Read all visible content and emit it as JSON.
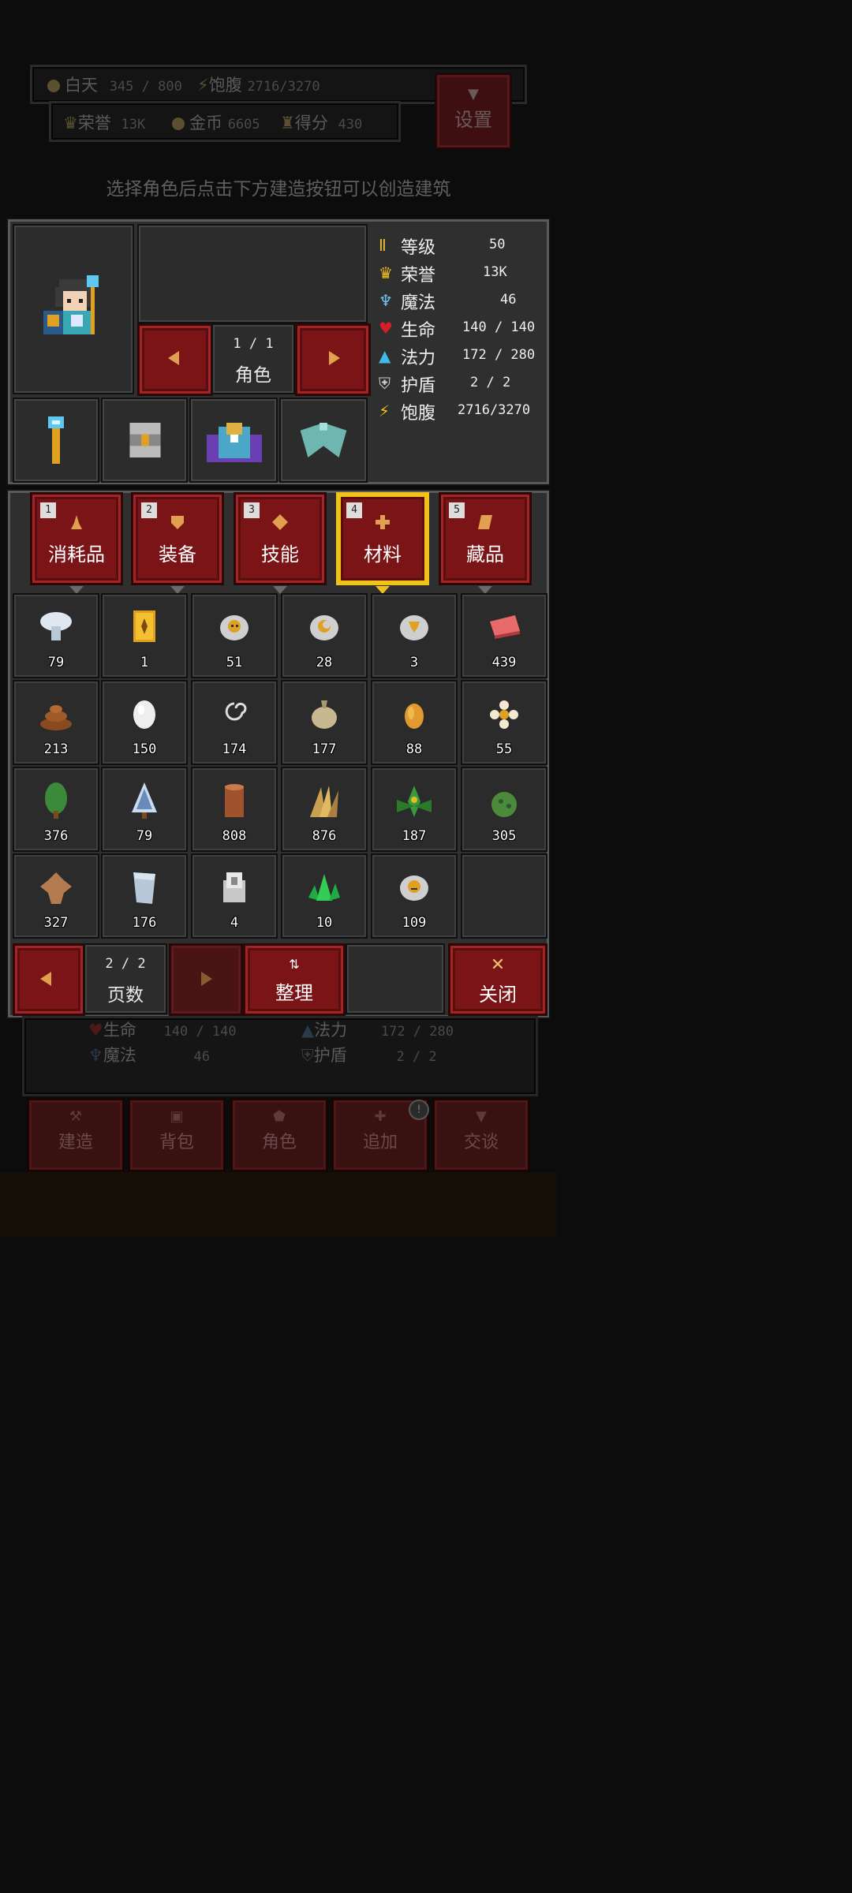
{
  "hud": {
    "day_label": "白天",
    "day_value": "345 / 800",
    "satiety_label": "饱腹",
    "satiety_value": "2716/3270",
    "honor_label": "荣誉",
    "honor_value": "13K",
    "gold_label": "金币",
    "gold_value": "6605",
    "score_label": "得分",
    "score_value": "430",
    "settings_label": "设置"
  },
  "hint": "选择角色后点击下方建造按钮可以创造建筑",
  "character": {
    "page": "1  /  1",
    "label": "角色"
  },
  "stats": [
    {
      "label": "等级",
      "value": "50",
      "icon": "level-icon",
      "color": "#e0b93a"
    },
    {
      "label": "荣誉",
      "value": "13K",
      "icon": "crown-icon",
      "color": "#f0c020"
    },
    {
      "label": "魔法",
      "value": "46",
      "icon": "staff-icon",
      "color": "#6ec6f0"
    },
    {
      "label": "生命",
      "value": "140 / 140",
      "icon": "heart-icon",
      "color": "#d0202a"
    },
    {
      "label": "法力",
      "value": "172 / 280",
      "icon": "potion-icon",
      "color": "#40b8e8"
    },
    {
      "label": "护盾",
      "value": "2  /  2",
      "icon": "shield-icon",
      "color": "#cfcfcf"
    },
    {
      "label": "饱腹",
      "value": "2716/3270",
      "icon": "satiety-icon",
      "color": "#f0c020"
    }
  ],
  "tabs": [
    {
      "num": "1",
      "label": "消耗品",
      "icon": "flask-icon"
    },
    {
      "num": "2",
      "label": "装备",
      "icon": "armor-icon"
    },
    {
      "num": "3",
      "label": "技能",
      "icon": "skill-icon"
    },
    {
      "num": "4",
      "label": "材料",
      "icon": "material-icon"
    },
    {
      "num": "5",
      "label": "藏品",
      "icon": "scroll-icon"
    }
  ],
  "active_tab": "材料",
  "items": [
    {
      "name": "mushroom-icon",
      "count": "79"
    },
    {
      "name": "golden-card-icon",
      "count": "1"
    },
    {
      "name": "skull-coin-icon",
      "count": "51"
    },
    {
      "name": "moon-coin-icon",
      "count": "28"
    },
    {
      "name": "horn-coin-icon",
      "count": "3"
    },
    {
      "name": "meat-icon",
      "count": "439"
    },
    {
      "name": "dung-icon",
      "count": "213"
    },
    {
      "name": "egg-icon",
      "count": "150"
    },
    {
      "name": "thread-icon",
      "count": "174"
    },
    {
      "name": "onion-icon",
      "count": "177"
    },
    {
      "name": "seed-icon",
      "count": "88"
    },
    {
      "name": "flower-icon",
      "count": "55"
    },
    {
      "name": "pine-tree-icon",
      "count": "376"
    },
    {
      "name": "snow-tree-icon",
      "count": "79"
    },
    {
      "name": "log-icon",
      "count": "808"
    },
    {
      "name": "wheat-icon",
      "count": "876"
    },
    {
      "name": "herb-icon",
      "count": "187"
    },
    {
      "name": "cactus-icon",
      "count": "305"
    },
    {
      "name": "leather-icon",
      "count": "327"
    },
    {
      "name": "cloth-icon",
      "count": "176"
    },
    {
      "name": "stone-icon",
      "count": "4"
    },
    {
      "name": "emerald-icon",
      "count": "10"
    },
    {
      "name": "face-coin-icon",
      "count": "109"
    }
  ],
  "pager": {
    "value": "2  /  2",
    "label": "页数"
  },
  "sort_label": "整理",
  "close_label": "关闭",
  "under": {
    "life_label": "生命",
    "life_value": "140 / 140",
    "mana_label": "法力",
    "mana_value": "172 / 280",
    "magic_label": "魔法",
    "magic_value": "46",
    "shield_label": "护盾",
    "shield_value": "2  /  2"
  },
  "nav": [
    {
      "label": "建造",
      "icon": "hammer-icon"
    },
    {
      "label": "背包",
      "icon": "bag-icon"
    },
    {
      "label": "角色",
      "icon": "character-icon"
    },
    {
      "label": "追加",
      "icon": "plus-icon"
    },
    {
      "label": "交谈",
      "icon": "chat-icon"
    }
  ]
}
